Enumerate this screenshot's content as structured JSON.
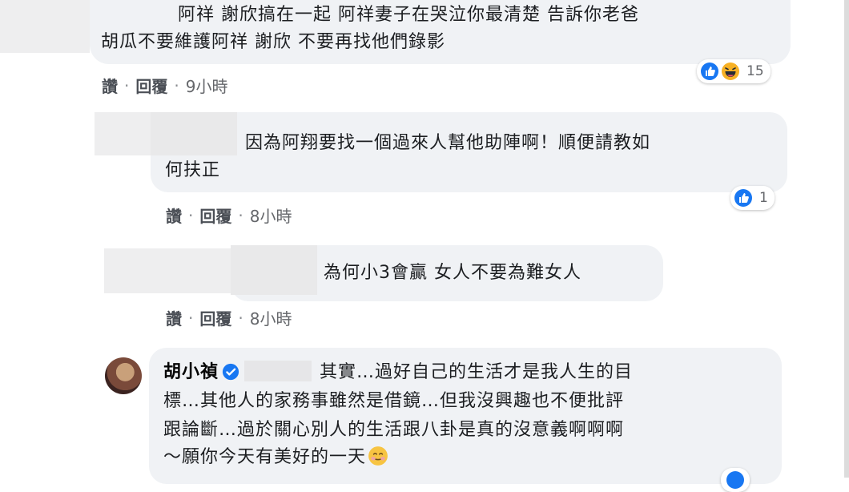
{
  "comments": [
    {
      "text_line1": "阿祥 謝欣搞在一起 阿祥妻子在哭泣你最清楚 告訴你老爸",
      "text_line2": "胡瓜不要維護阿祥 謝欣 不要再找他們錄影",
      "like_label": "讚",
      "reply_label": "回覆",
      "time": "9小時",
      "reaction_count": "15",
      "reactions": [
        "like-icon",
        "haha-icon"
      ]
    },
    {
      "text_line1": "因為阿翔要找一個過來人幫他助陣啊！順便請教如",
      "text_line2": "何扶正",
      "like_label": "讚",
      "reply_label": "回覆",
      "time": "8小時",
      "reaction_count": "1",
      "reactions": [
        "like-icon"
      ]
    },
    {
      "text_line1": "為何小3會贏 女人不要為難女人",
      "like_label": "讚",
      "reply_label": "回覆",
      "time": "8小時"
    },
    {
      "author": "胡小禎",
      "text_line1": "其實…過好自己的生活才是我人生的目",
      "text_line2": "標…其他人的家務事雖然是借鏡…但我沒興趣也不便批評",
      "text_line3": "跟論斷…過於關心別人的生活跟八卦是真的沒意義啊啊啊",
      "text_line4": "～願你今天有美好的一天",
      "emoji": "smiling-face-icon"
    }
  ],
  "colors": {
    "bubble": "#f0f2f5",
    "like_blue": "#1877f2",
    "haha_yellow": "#f7b125"
  }
}
